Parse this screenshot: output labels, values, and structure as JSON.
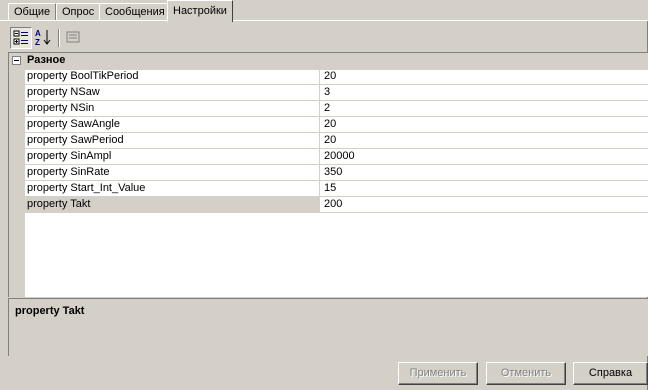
{
  "tabs": [
    {
      "label": "Общие"
    },
    {
      "label": "Опрос"
    },
    {
      "label": "Сообщения"
    },
    {
      "label": "Настройки",
      "active": true
    }
  ],
  "toolbar": {
    "buttons": [
      {
        "name": "categorized-view",
        "pressed": true
      },
      {
        "name": "alphabetical-sort",
        "pressed": false
      },
      {
        "name": "property-pages",
        "pressed": false,
        "disabled": true
      }
    ]
  },
  "grid": {
    "category": "Разное",
    "properties": [
      {
        "name": "property BoolTikPeriod",
        "value": "20"
      },
      {
        "name": "property NSaw",
        "value": "3"
      },
      {
        "name": "property NSin",
        "value": "2"
      },
      {
        "name": "property SawAngle",
        "value": "20"
      },
      {
        "name": "property SawPeriod",
        "value": "20"
      },
      {
        "name": "property SinAmpl",
        "value": "20000"
      },
      {
        "name": "property SinRate",
        "value": "350"
      },
      {
        "name": "property Start_Int_Value",
        "value": "15"
      },
      {
        "name": "property Takt",
        "value": "200",
        "selected": true
      }
    ]
  },
  "description": {
    "title": "property Takt"
  },
  "buttons": {
    "apply": "Применить",
    "cancel": "Отменить",
    "help": "Справка"
  }
}
